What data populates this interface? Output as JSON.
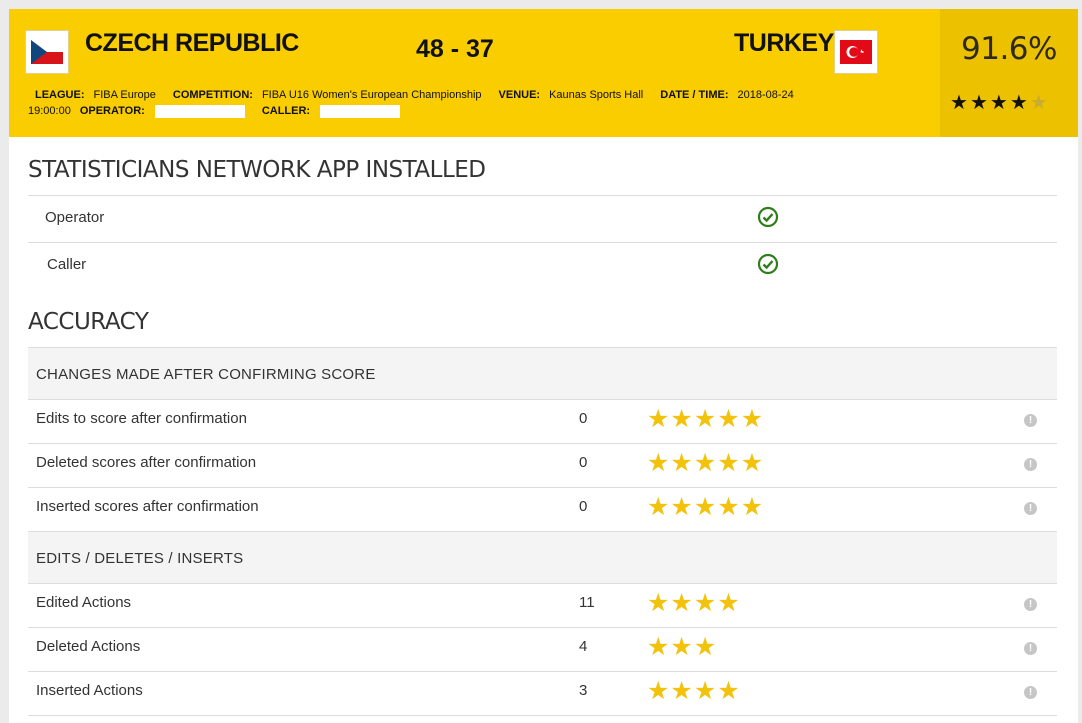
{
  "match": {
    "home_team": "CZECH REPUBLIC",
    "away_team": "TURKEY",
    "score": "48 - 37",
    "percentage": "91.6%",
    "rating": 4,
    "rating_max": 5
  },
  "meta": {
    "league_label": "LEAGUE:",
    "league": "FIBA Europe",
    "competition_label": "COMPETITION:",
    "competition": "FIBA U16 Women's European Championship",
    "venue_label": "VENUE:",
    "venue": "Kaunas Sports Hall",
    "datetime_label": "DATE / TIME:",
    "date": "2018-08-24",
    "time": "19:00:00",
    "operator_label": "OPERATOR:",
    "caller_label": "CALLER:"
  },
  "app_section": {
    "title": "STATISTICIANS NETWORK APP INSTALLED",
    "rows": [
      {
        "label": "Operator",
        "installed": true
      },
      {
        "label": "Caller",
        "installed": true
      }
    ]
  },
  "accuracy": {
    "title": "ACCURACY",
    "groups": [
      {
        "title": "CHANGES MADE AFTER CONFIRMING SCORE",
        "rows": [
          {
            "label": "Edits to score after confirmation",
            "value": "0",
            "stars": 5
          },
          {
            "label": "Deleted scores after confirmation",
            "value": "0",
            "stars": 5
          },
          {
            "label": "Inserted scores after confirmation",
            "value": "0",
            "stars": 5
          }
        ]
      },
      {
        "title": "EDITS / DELETES / INSERTS",
        "rows": [
          {
            "label": "Edited Actions",
            "value": "11",
            "stars": 4
          },
          {
            "label": "Deleted Actions",
            "value": "4",
            "stars": 3
          },
          {
            "label": "Inserted Actions",
            "value": "3",
            "stars": 4
          }
        ]
      }
    ]
  },
  "colors": {
    "header_bg": "#f9cd00",
    "score_box_bg": "#ecc100",
    "star": "#f3c20a",
    "check": "#2e7d1a"
  },
  "icons": {
    "check": "check-circle-icon",
    "info": "info-icon",
    "star": "star-icon"
  }
}
